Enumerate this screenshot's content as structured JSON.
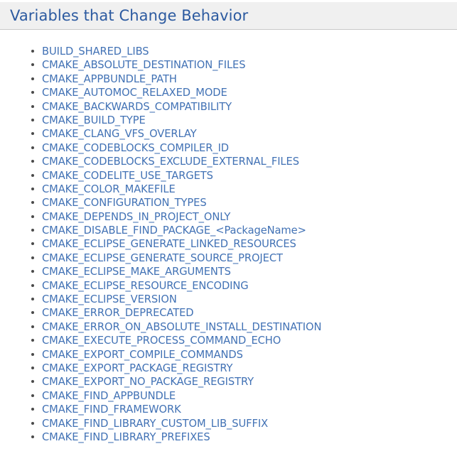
{
  "page": {
    "title": "Variables that Change Behavior",
    "background_color": "#ffffff"
  },
  "header": {
    "title": "Variables that Change Behavior",
    "background_color": "#f0f0f0",
    "border_color": "#c9c9c9",
    "text_color": "#2c5aa0"
  },
  "variable_list": {
    "link_color": "#4272b5",
    "bullet_color": "#4a4a4a",
    "items": [
      {
        "label": "BUILD_SHARED_LIBS"
      },
      {
        "label": "CMAKE_ABSOLUTE_DESTINATION_FILES"
      },
      {
        "label": "CMAKE_APPBUNDLE_PATH"
      },
      {
        "label": "CMAKE_AUTOMOC_RELAXED_MODE"
      },
      {
        "label": "CMAKE_BACKWARDS_COMPATIBILITY"
      },
      {
        "label": "CMAKE_BUILD_TYPE"
      },
      {
        "label": "CMAKE_CLANG_VFS_OVERLAY"
      },
      {
        "label": "CMAKE_CODEBLOCKS_COMPILER_ID"
      },
      {
        "label": "CMAKE_CODEBLOCKS_EXCLUDE_EXTERNAL_FILES"
      },
      {
        "label": "CMAKE_CODELITE_USE_TARGETS"
      },
      {
        "label": "CMAKE_COLOR_MAKEFILE"
      },
      {
        "label": "CMAKE_CONFIGURATION_TYPES"
      },
      {
        "label": "CMAKE_DEPENDS_IN_PROJECT_ONLY"
      },
      {
        "label": "CMAKE_DISABLE_FIND_PACKAGE_<PackageName>"
      },
      {
        "label": "CMAKE_ECLIPSE_GENERATE_LINKED_RESOURCES"
      },
      {
        "label": "CMAKE_ECLIPSE_GENERATE_SOURCE_PROJECT"
      },
      {
        "label": "CMAKE_ECLIPSE_MAKE_ARGUMENTS"
      },
      {
        "label": "CMAKE_ECLIPSE_RESOURCE_ENCODING"
      },
      {
        "label": "CMAKE_ECLIPSE_VERSION"
      },
      {
        "label": "CMAKE_ERROR_DEPRECATED"
      },
      {
        "label": "CMAKE_ERROR_ON_ABSOLUTE_INSTALL_DESTINATION"
      },
      {
        "label": "CMAKE_EXECUTE_PROCESS_COMMAND_ECHO"
      },
      {
        "label": "CMAKE_EXPORT_COMPILE_COMMANDS"
      },
      {
        "label": "CMAKE_EXPORT_PACKAGE_REGISTRY"
      },
      {
        "label": "CMAKE_EXPORT_NO_PACKAGE_REGISTRY"
      },
      {
        "label": "CMAKE_FIND_APPBUNDLE"
      },
      {
        "label": "CMAKE_FIND_FRAMEWORK"
      },
      {
        "label": "CMAKE_FIND_LIBRARY_CUSTOM_LIB_SUFFIX"
      },
      {
        "label": "CMAKE_FIND_LIBRARY_PREFIXES"
      }
    ]
  }
}
